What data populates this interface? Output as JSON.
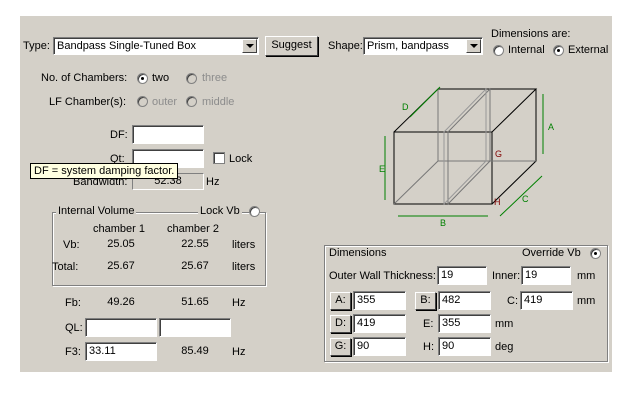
{
  "top": {
    "type_label": "Type:",
    "type_value": "Bandpass Single-Tuned Box",
    "suggest_label": "Suggest",
    "shape_label": "Shape:",
    "shape_value": "Prism, bandpass",
    "dims_are_label": "Dimensions are:",
    "dims_internal": "Internal",
    "dims_external": "External",
    "dims_selected": "External"
  },
  "chambers": {
    "no_label": "No. of Chambers:",
    "opt_two": "two",
    "opt_three": "three",
    "lf_label": "LF Chamber(s):",
    "opt_outer": "outer",
    "opt_middle": "middle"
  },
  "params": {
    "df_label": "DF:",
    "df_value": "",
    "qt_label": "Qt:",
    "qt_value": "",
    "lock_label": "Lock",
    "bandwidth_label": "Bandwidth:",
    "bandwidth_value": "52.38",
    "bandwidth_unit": "Hz",
    "tooltip": "DF = system damping factor."
  },
  "volume": {
    "title": "Internal Volume",
    "lock_label": "Lock Vb",
    "col1": "chamber 1",
    "col2": "chamber 2",
    "vb_label": "Vb:",
    "vb1": "25.05",
    "vb2": "22.55",
    "vb_unit": "liters",
    "total_label": "Total:",
    "total1": "25.67",
    "total2": "25.67",
    "total_unit": "liters"
  },
  "tuning": {
    "fb_label": "Fb:",
    "fb1": "49.26",
    "fb2": "51.65",
    "fb_unit": "Hz",
    "ql_label": "QL:",
    "ql1": "",
    "ql2": "",
    "f3_label": "F3:",
    "f3_1": "33.11",
    "f3_2": "85.49",
    "f3_unit": "Hz"
  },
  "diagram": {
    "labels": {
      "A": "A",
      "B": "B",
      "C": "C",
      "D": "D",
      "E": "E",
      "G": "G",
      "H": "H"
    },
    "colors": {
      "lines": "#000000",
      "dims": "#008000",
      "angle": "#800000"
    }
  },
  "dimensions": {
    "title": "Dimensions",
    "override_label": "Override Vb",
    "outer_label": "Outer Wall Thickness:",
    "outer_value": "19",
    "inner_label": "Inner:",
    "inner_value": "19",
    "mm1": "mm",
    "a_label": "A:",
    "a_value": "355",
    "b_label": "B:",
    "b_value": "482",
    "c_label": "C:",
    "c_value": "419",
    "mm2": "mm",
    "d_label": "D:",
    "d_value": "419",
    "e_label": "E:",
    "e_value": "355",
    "mm3": "mm",
    "g_label": "G:",
    "g_value": "90",
    "h_label": "H:",
    "h_value": "90",
    "deg": "deg"
  }
}
